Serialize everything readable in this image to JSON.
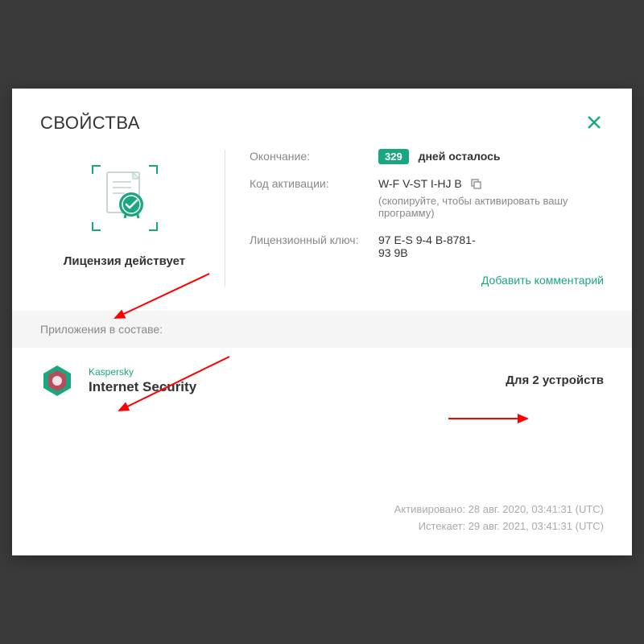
{
  "modal": {
    "title": "СВОЙСТВА"
  },
  "license": {
    "status": "Лицензия действует",
    "expiration_label": "Окончание:",
    "days_remaining": "329",
    "days_text": "дней осталось",
    "activation_code_label": "Код активации:",
    "activation_code": "    W-F     V-ST    I-HJ    B",
    "copy_hint": "(скопируйте, чтобы активировать вашу программу)",
    "license_key_label": "Лицензионный ключ:",
    "license_key_l1": "97        E-S    9-4    B-8781-",
    "license_key_l2": "93             9B",
    "add_comment": "Добавить комментарий"
  },
  "apps": {
    "section_label": "Приложения в составе:",
    "brand": "Kaspersky",
    "product": "Internet Security",
    "devices": "Для 2 устройств"
  },
  "footer": {
    "activated": "Активировано: 28 авг. 2020, 03:41:31 (UTC)",
    "expires": "Истекает: 29 авг. 2021, 03:41:31 (UTC)"
  }
}
